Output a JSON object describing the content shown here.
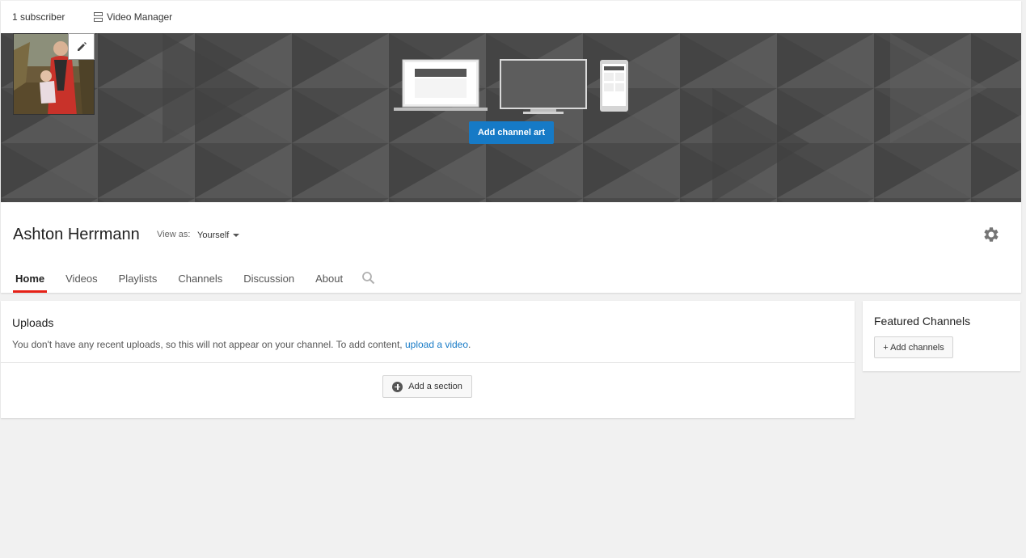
{
  "header": {
    "subscriber_count": "1 subscriber",
    "video_manager_label": "Video Manager",
    "video_manager_icon": "video-manager-icon"
  },
  "banner": {
    "add_channel_art_label": "Add channel art",
    "colors": {
      "background": "#4f4f4f",
      "button": "#167ac6"
    },
    "device_icons": [
      "laptop-icon",
      "tv-icon",
      "phone-icon"
    ]
  },
  "avatar": {
    "edit_icon": "pencil-icon"
  },
  "channel": {
    "name": "Ashton Herrmann",
    "view_as_label": "View as:",
    "view_as_value": "Yourself",
    "settings_icon": "gear-icon"
  },
  "tabs": [
    {
      "label": "Home",
      "active": true
    },
    {
      "label": "Videos",
      "active": false
    },
    {
      "label": "Playlists",
      "active": false
    },
    {
      "label": "Channels",
      "active": false
    },
    {
      "label": "Discussion",
      "active": false
    },
    {
      "label": "About",
      "active": false
    }
  ],
  "tab_search_icon": "search-icon",
  "tab_active_color": "#e62117",
  "uploads": {
    "title": "Uploads",
    "message_prefix": "You don't have any recent uploads, so this will not appear on your channel. To add content, ",
    "message_link": "upload a video",
    "message_suffix": ".",
    "add_section_label": "Add a section",
    "add_section_icon": "plus-circle-icon"
  },
  "featured": {
    "title": "Featured Channels",
    "add_channels_label": "+ Add channels"
  }
}
